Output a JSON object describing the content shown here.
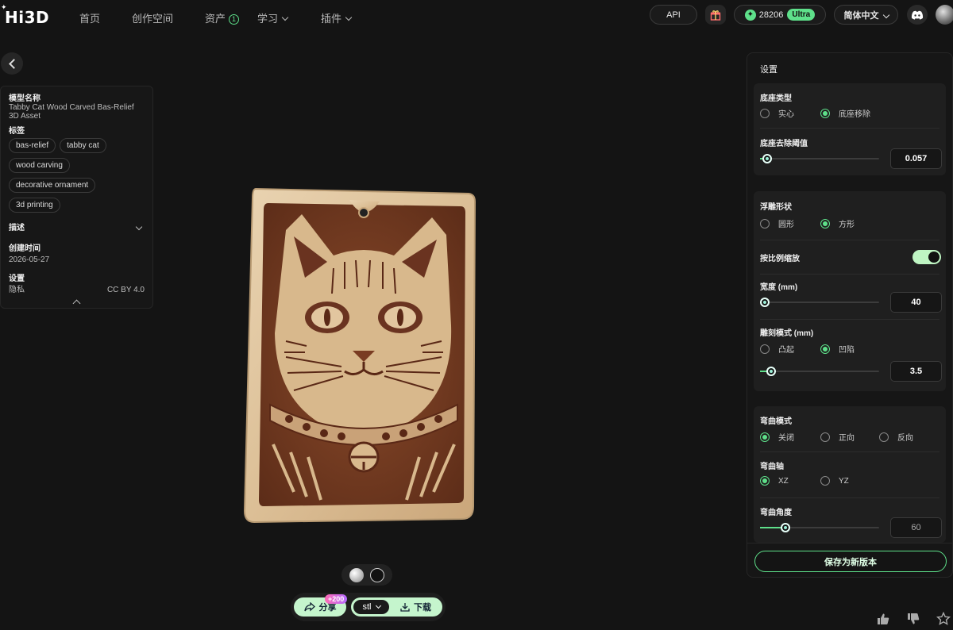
{
  "header": {
    "logo": "Hi3D",
    "nav": {
      "home": "首页",
      "workspace": "创作空间",
      "assets": "资产",
      "assets_badge": "1",
      "learn": "学习",
      "plugins": "插件"
    },
    "api_label": "API",
    "credits": "28206",
    "plan_badge": "Ultra",
    "language": "简体中文"
  },
  "info": {
    "name_label": "模型名称",
    "name_value": "Tabby Cat Wood Carved Bas-Relief 3D Asset",
    "tags_label": "标签",
    "tags": [
      "bas-relief",
      "tabby cat",
      "wood carving",
      "decorative ornament",
      "3d printing"
    ],
    "description_label": "描述",
    "created_label": "创建时间",
    "created_value": "2026-05-27",
    "settings_label": "设置",
    "privacy_value": "隐私",
    "license_value": "CC BY 4.0"
  },
  "actions": {
    "share_label": "分享",
    "share_bonus": "+200",
    "format_value": "stl",
    "download_label": "下载"
  },
  "settings": {
    "title": "设置",
    "base_type": {
      "label": "底座类型",
      "options": [
        "实心",
        "底座移除"
      ],
      "selected": 1
    },
    "base_threshold": {
      "label": "底座去除阈值",
      "value": "0.057",
      "level": 0.02
    },
    "relief_shape": {
      "label": "浮雕形状",
      "options": [
        "圆形",
        "方形"
      ],
      "selected": 1
    },
    "proportional_scale": {
      "label": "按比例缩放",
      "on": true
    },
    "width": {
      "label": "宽度 (mm)",
      "value": "40",
      "level": 0.0
    },
    "carve_mode": {
      "label": "雕刻模式 (mm)",
      "options": [
        "凸起",
        "凹陷"
      ],
      "selected": 1,
      "value": "3.5",
      "level": 0.05
    },
    "bend_mode": {
      "label": "弯曲模式",
      "options": [
        "关闭",
        "正向",
        "反向"
      ],
      "selected": 0
    },
    "bend_axis": {
      "label": "弯曲轴",
      "options": [
        "XZ",
        "YZ"
      ],
      "selected": 0
    },
    "bend_angle": {
      "label": "弯曲角度",
      "value": "60",
      "level": 0.17
    },
    "save_label": "保存为新版本"
  },
  "colors": {
    "accent": "#5ee08a",
    "background": "#141414",
    "panel": "#1f1f1f"
  }
}
